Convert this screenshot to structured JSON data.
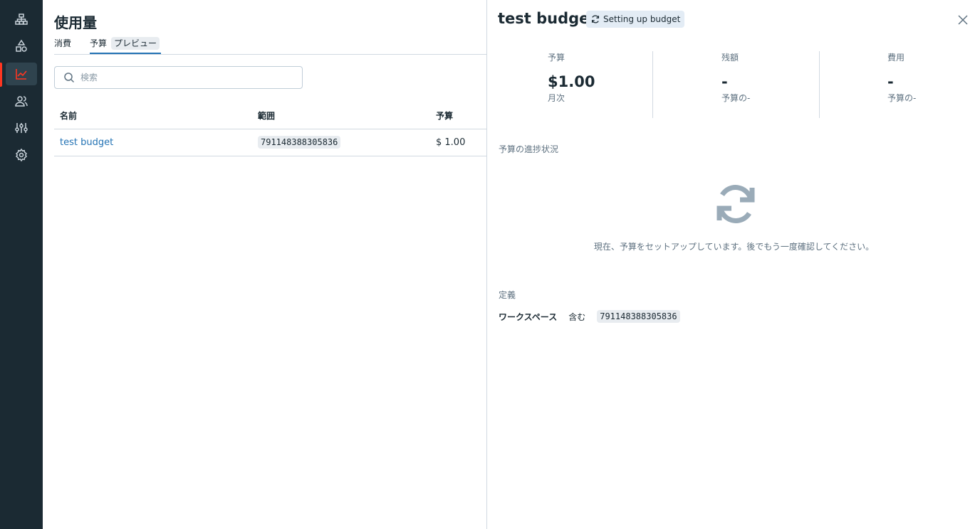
{
  "sidebar": {
    "items": [
      {
        "icon": "sitemap-icon"
      },
      {
        "icon": "shapes-icon"
      },
      {
        "icon": "chart-line-icon",
        "active": true
      },
      {
        "icon": "users-icon"
      },
      {
        "icon": "sliders-icon"
      },
      {
        "icon": "gear-icon"
      }
    ],
    "accent": "#ff3621"
  },
  "page": {
    "title": "使用量",
    "tabs": [
      {
        "label": "消費"
      },
      {
        "label": "予算",
        "tag": "プレビュー",
        "active": true
      }
    ],
    "search": {
      "placeholder": "検索",
      "value": ""
    },
    "table": {
      "columns": [
        "名前",
        "範囲",
        "予算"
      ],
      "rows": [
        {
          "name": "test budget",
          "scope": "791148388305836",
          "budget": "$ 1.00"
        }
      ]
    }
  },
  "panel": {
    "title": "test budget",
    "status": "Setting up budget",
    "stats": [
      {
        "label": "予算",
        "value": "$1.00",
        "sub": "月次"
      },
      {
        "label": "残額",
        "value": "-",
        "sub": "予算の-"
      },
      {
        "label": "費用",
        "value": "-",
        "sub": "予算の-"
      }
    ],
    "progress_label": "予算の進捗状況",
    "setup_message": "現在、予算をセットアップしています。後でもう一度確認してください。",
    "definition_label": "定義",
    "definition": {
      "kind": "ワークスペース",
      "operator": "含む",
      "value": "791148388305836"
    }
  }
}
